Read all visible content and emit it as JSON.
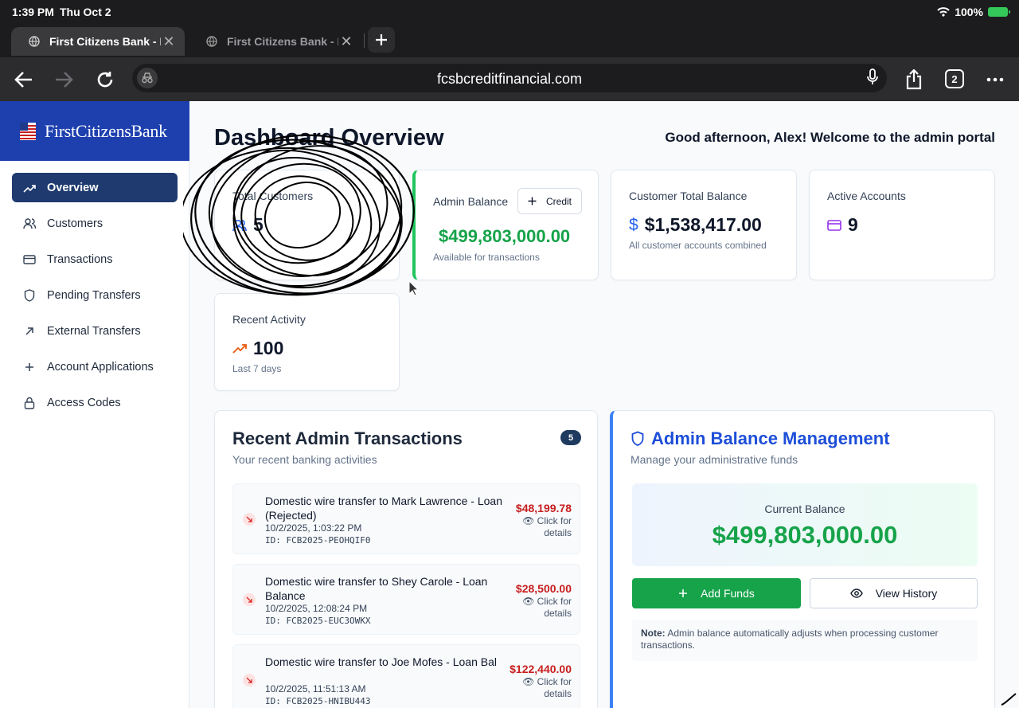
{
  "status_bar": {
    "time": "1:39 PM",
    "date": "Thu Oct 2",
    "battery": "100%"
  },
  "browser": {
    "tabs": [
      {
        "title": "First Citizens Bank - Pe",
        "active": true
      },
      {
        "title": "First Citizens Bank - Pe",
        "active": false
      }
    ],
    "url": "fcsbcreditfinancial.com",
    "tab_count": "2"
  },
  "sidebar": {
    "brand": "FirstCitizensBank",
    "items": [
      {
        "label": "Overview",
        "icon": "trending-up-icon",
        "active": true
      },
      {
        "label": "Customers",
        "icon": "users-icon"
      },
      {
        "label": "Transactions",
        "icon": "credit-card-icon"
      },
      {
        "label": "Pending Transfers",
        "icon": "shield-icon"
      },
      {
        "label": "External Transfers",
        "icon": "arrow-up-right-icon"
      },
      {
        "label": "Account Applications",
        "icon": "plus-icon"
      },
      {
        "label": "Access Codes",
        "icon": "lock-icon"
      }
    ]
  },
  "header": {
    "title": "Dashboard Overview",
    "greeting": "Good afternoon, Alex! Welcome to the admin portal"
  },
  "stats": {
    "total_customers": {
      "label": "Total Customers",
      "value": "5"
    },
    "admin_balance": {
      "label": "Admin Balance",
      "button": "Credit",
      "value": "$499,803,000.00",
      "sub": "Available for transactions"
    },
    "customer_total": {
      "label": "Customer Total Balance",
      "value": "$1,538,417.00",
      "sub": "All customer accounts combined"
    },
    "active_accounts": {
      "label": "Active Accounts",
      "value": "9"
    },
    "recent_activity": {
      "label": "Recent Activity",
      "value": "100",
      "sub": "Last 7 days"
    }
  },
  "recent_transactions": {
    "title": "Recent Admin Transactions",
    "subtitle": "Your recent banking activities",
    "count": "5",
    "click_label": "Click for details",
    "items": [
      {
        "description": "Domestic wire transfer to Mark Lawrence - Loan (Rejected)",
        "datetime": "10/2/2025, 1:03:22 PM",
        "id": "ID: FCB2025-PEOHQIF0",
        "amount": "$48,199.78"
      },
      {
        "description": "Domestic wire transfer to Shey Carole - Loan Balance",
        "datetime": "10/2/2025, 12:08:24 PM",
        "id": "ID: FCB2025-EUC3OWKX",
        "amount": "$28,500.00"
      },
      {
        "description": "Domestic wire transfer to Joe Mofes - Loan Bal",
        "datetime": "10/2/2025, 11:51:13 AM",
        "id": "ID: FCB2025-HNIBU443",
        "amount": "$122,440.00"
      }
    ]
  },
  "balance_management": {
    "title": "Admin Balance Management",
    "subtitle": "Manage your administrative funds",
    "current_label": "Current Balance",
    "current_value": "$499,803,000.00",
    "add_funds": "Add Funds",
    "view_history": "View History",
    "note_label": "Note:",
    "note_text": "Admin balance automatically adjusts when processing customer transactions."
  },
  "colors": {
    "brand": "#1e40af",
    "nav_active": "#1e3a6e",
    "positive": "#16a34a",
    "negative": "#c81e1e"
  }
}
